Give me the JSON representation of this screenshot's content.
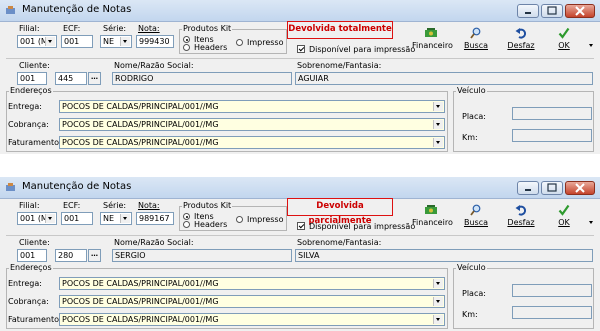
{
  "windows": [
    {
      "title": "Manutenção de Notas",
      "filial_label": "Filial:",
      "filial_value": "001 (M",
      "ecf_label": "ECF:",
      "ecf_value": "001",
      "serie_label": "Série:",
      "serie_value": "NE",
      "nota_label": "Nota:",
      "nota_value": "999430",
      "produtos_kit_label": "Produtos Kit",
      "itens_label": "Itens",
      "headers_label": "Headers",
      "impresso_label": "Impresso",
      "status_text": "Devolvida totalmente",
      "disponivel_label": "Disponível para impressão",
      "toolbar": {
        "financeiro": "Financeiro",
        "busca": "Busca",
        "desfaz": "Desfaz",
        "ok": "OK"
      },
      "cliente_label": "Cliente:",
      "cliente_code": "001",
      "cliente_num": "445",
      "nome_label": "Nome/Razão Social:",
      "nome_value": "RODRIGO",
      "sobrenome_label": "Sobrenome/Fantasia:",
      "sobrenome_value": "AGUIAR",
      "enderecos_label": "Endereços",
      "entrega_label": "Entrega:",
      "entrega_value": "POCOS DE CALDAS/PRINCIPAL/001//MG",
      "cobranca_label": "Cobrança:",
      "cobranca_value": "POCOS DE CALDAS/PRINCIPAL/001//MG",
      "faturamento_label": "Faturamento:",
      "faturamento_value": "POCOS DE CALDAS/PRINCIPAL/001//MG",
      "veiculo_label": "Veículo",
      "placa_label": "Placa:",
      "km_label": "Km:"
    },
    {
      "title": "Manutenção de Notas",
      "filial_label": "Filial:",
      "filial_value": "001 (M",
      "ecf_label": "ECF:",
      "ecf_value": "001",
      "serie_label": "Série:",
      "serie_value": "NE",
      "nota_label": "Nota:",
      "nota_value": "989167",
      "produtos_kit_label": "Produtos Kit",
      "itens_label": "Itens",
      "headers_label": "Headers",
      "impresso_label": "Impresso",
      "status_text": "Devolvida parcialmente",
      "disponivel_label": "Disponível para impressão",
      "toolbar": {
        "financeiro": "Financeiro",
        "busca": "Busca",
        "desfaz": "Desfaz",
        "ok": "OK"
      },
      "cliente_label": "Cliente:",
      "cliente_code": "001",
      "cliente_num": "280",
      "nome_label": "Nome/Razão Social:",
      "nome_value": "SERGIO",
      "sobrenome_label": "Sobrenome/Fantasia:",
      "sobrenome_value": "SILVA",
      "enderecos_label": "Endereços",
      "entrega_label": "Entrega:",
      "entrega_value": "POCOS DE CALDAS/PRINCIPAL/001//MG",
      "cobranca_label": "Cobrança:",
      "cobranca_value": "POCOS DE CALDAS/PRINCIPAL/001//MG",
      "faturamento_label": "Faturamento:",
      "faturamento_value": "POCOS DE CALDAS/PRINCIPAL/001//MG",
      "veiculo_label": "Veículo",
      "placa_label": "Placa:",
      "km_label": "Km:"
    }
  ],
  "colors": {
    "status_text": "#cc0000",
    "status_border": "#dd1111",
    "field_yellow": "#ffffe1"
  },
  "icons": [
    "app-icon",
    "financeiro-icon",
    "busca-icon",
    "desfaz-icon",
    "ok-icon"
  ]
}
